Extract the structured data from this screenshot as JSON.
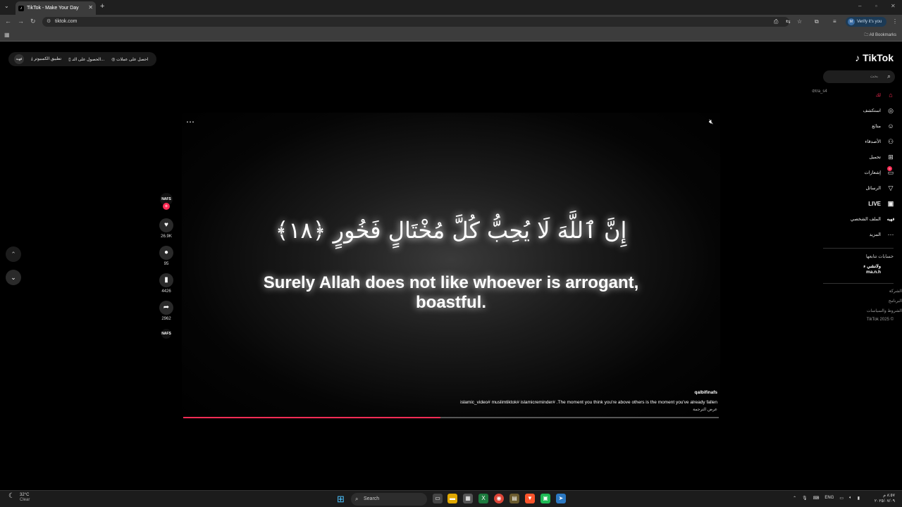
{
  "browser": {
    "tab_title": "TikTok - Make Your Day",
    "url": "tiktok.com",
    "verify_label": "Verify it's you",
    "all_bookmarks": "All Bookmarks"
  },
  "topbar": {
    "get_coins": "احصل على عملات",
    "get_app": "الحصول على التـ...",
    "desktop_app": "تطبيق الكمبيوتر",
    "avatar_text": "فهيه"
  },
  "sidebar": {
    "logo": "TikTok",
    "search_placeholder": "بحث",
    "pulse_text": "tra_s4",
    "items": [
      {
        "label": "ﻟﻚ",
        "icon": "home-icon"
      },
      {
        "label": "استكشف",
        "icon": "compass-icon"
      },
      {
        "label": "متابَع",
        "icon": "person-icon"
      },
      {
        "label": "الأصدقاء",
        "icon": "friends-icon"
      },
      {
        "label": "تحميل",
        "icon": "plus-icon"
      },
      {
        "label": "إشعارات",
        "icon": "inbox-icon"
      },
      {
        "label": "الرسائل",
        "icon": "send-icon"
      },
      {
        "label": "LIVE",
        "icon": "live-icon"
      },
      {
        "label": "الملف الشخصي",
        "icon": "profile-icon"
      },
      {
        "label": "المزيد",
        "icon": "more-icon"
      }
    ],
    "notif_badge": "9",
    "following_title": "حسابات تتابعها",
    "following_user_line1": "ﻭﻻﻧﺸﻲ ﺀ",
    "following_user_line2": "ma.n.h",
    "footer": [
      "الشركة",
      "البرنامج",
      "الشروط والسياسات",
      "TikTok 2025 ©"
    ]
  },
  "video": {
    "arabic_text": "إِنَّ ٱللَّهَ لَا يُحِبُّ كُلَّ مُخْتَالٍ فَخُورٍ ﴿١٨﴾",
    "english_text": "Surely Allah does not like whoever is arrogant, boastful.",
    "author": "qalbifinafs",
    "caption": "islamic_video#  muslimtiktok#  islamicreminder# .The moment you think you're above others is the moment you've already fallen",
    "translate_label": "عرض الترجمة",
    "progress": 0.48
  },
  "actions": {
    "creator_avatar": "NAFS",
    "likes": "26.9K",
    "comments": "95",
    "saves": "4426",
    "shares": "2962",
    "sound_avatar": "NAFS"
  },
  "taskbar": {
    "weather_temp": "32°C",
    "weather_desc": "Clear",
    "search_label": "Search",
    "lang": "ENG",
    "time": "٨:٥٧ م",
    "date": "٢٠٢٥/٠٧/٠٩"
  }
}
